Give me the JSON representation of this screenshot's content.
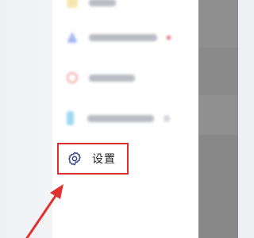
{
  "menu": {
    "items": [
      {
        "icon": "yellow-item-icon",
        "color": "#f3d26a",
        "has_badge": false
      },
      {
        "icon": "blue-triangle-icon",
        "color": "#5b7be3",
        "has_badge": true,
        "badge_color": "#e25b63"
      },
      {
        "icon": "red-circle-icon",
        "color": "#e05a5a",
        "has_badge": false
      },
      {
        "icon": "cyan-bottle-icon",
        "color": "#4fb9e3",
        "has_badge": false
      }
    ],
    "settings": {
      "label": "设置",
      "icon": "gear-icon",
      "icon_color": "#3b4a8c"
    }
  },
  "annotation": {
    "highlight_color": "#df2d2d",
    "arrow_color": "#e0322f"
  }
}
